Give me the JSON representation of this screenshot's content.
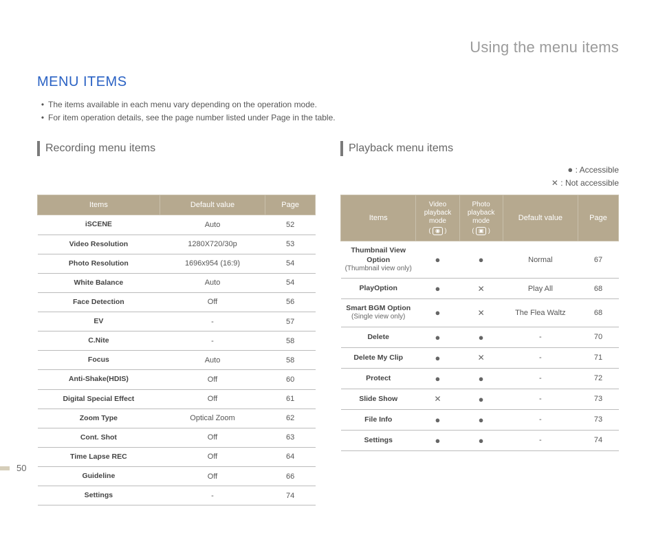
{
  "chapter": "Using the menu items",
  "section_title": "MENU ITEMS",
  "bullets": [
    "The items available in each menu vary depending on the operation mode.",
    "For item operation details, see the page number listed under Page in the table."
  ],
  "recording": {
    "heading": "Recording menu items",
    "headers": [
      "Items",
      "Default value",
      "Page"
    ],
    "rows": [
      {
        "item": "iSCENE",
        "default": "Auto",
        "page": "52"
      },
      {
        "item": "Video Resolution",
        "default": "1280X720/30p",
        "page": "53"
      },
      {
        "item": "Photo Resolution",
        "default": "1696x954 (16:9)",
        "page": "54"
      },
      {
        "item": "White Balance",
        "default": "Auto",
        "page": "54"
      },
      {
        "item": "Face Detection",
        "default": "Off",
        "page": "56"
      },
      {
        "item": "EV",
        "default": "-",
        "page": "57"
      },
      {
        "item": "C.Nite",
        "default": "-",
        "page": "58"
      },
      {
        "item": "Focus",
        "default": "Auto",
        "page": "58"
      },
      {
        "item": "Anti-Shake(HDIS)",
        "default": "Off",
        "page": "60"
      },
      {
        "item": "Digital Special Effect",
        "default": "Off",
        "page": "61"
      },
      {
        "item": "Zoom Type",
        "default": "Optical Zoom",
        "page": "62"
      },
      {
        "item": "Cont. Shot",
        "default": "Off",
        "page": "63"
      },
      {
        "item": "Time Lapse REC",
        "default": "Off",
        "page": "64"
      },
      {
        "item": "Guideline",
        "default": "Off",
        "page": "66"
      },
      {
        "item": "Settings",
        "default": "-",
        "page": "74"
      }
    ]
  },
  "playback": {
    "heading": "Playback menu items",
    "legend": {
      "accessible_symbol": "●",
      "accessible_text": ": Accessible",
      "not_symbol": "✕",
      "not_text": ": Not accessible"
    },
    "headers": {
      "items": "Items",
      "video_mode": "Video playback mode",
      "photo_mode": "Photo playback mode",
      "default": "Default value",
      "page": "Page",
      "video_icon_label": "video-playback-icon",
      "photo_icon_label": "photo-playback-icon"
    },
    "rows": [
      {
        "item": "Thumbnail View Option",
        "note": "(Thumbnail view only)",
        "video": "●",
        "photo": "●",
        "default": "Normal",
        "page": "67"
      },
      {
        "item": "PlayOption",
        "note": "",
        "video": "●",
        "photo": "✕",
        "default": "Play All",
        "page": "68"
      },
      {
        "item": "Smart BGM Option",
        "note": "(Single view only)",
        "video": "●",
        "photo": "✕",
        "default": "The Flea Waltz",
        "page": "68"
      },
      {
        "item": "Delete",
        "note": "",
        "video": "●",
        "photo": "●",
        "default": "-",
        "page": "70"
      },
      {
        "item": "Delete My Clip",
        "note": "",
        "video": "●",
        "photo": "✕",
        "default": "-",
        "page": "71"
      },
      {
        "item": "Protect",
        "note": "",
        "video": "●",
        "photo": "●",
        "default": "-",
        "page": "72"
      },
      {
        "item": "Slide Show",
        "note": "",
        "video": "✕",
        "photo": "●",
        "default": "-",
        "page": "73"
      },
      {
        "item": "File Info",
        "note": "",
        "video": "●",
        "photo": "●",
        "default": "-",
        "page": "73"
      },
      {
        "item": "Settings",
        "note": "",
        "video": "●",
        "photo": "●",
        "default": "-",
        "page": "74"
      }
    ]
  },
  "page_number": "50"
}
